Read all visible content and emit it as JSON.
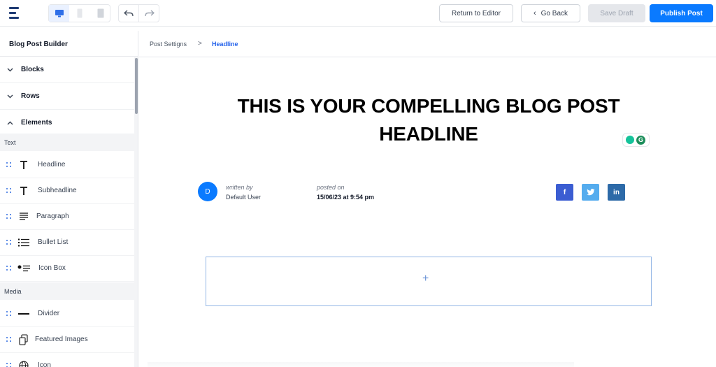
{
  "topbar": {
    "logo_icon": "logo-icon",
    "devices": [
      {
        "name": "desktop-icon",
        "active": true
      },
      {
        "name": "tablet-icon",
        "active": false
      },
      {
        "name": "mobile-icon",
        "active": false
      }
    ],
    "undo_icon": "undo-icon",
    "redo_icon": "redo-icon",
    "return_label": "Return to Editor",
    "back_label": "Go Back",
    "save_draft_label": "Save Draft",
    "publish_label": "Publish Post",
    "accent_color": "#0a7aff"
  },
  "sidebar": {
    "title": "Blog Post Builder",
    "accordions": [
      {
        "label": "Blocks",
        "expanded": false
      },
      {
        "label": "Rows",
        "expanded": false
      },
      {
        "label": "Elements",
        "expanded": true
      }
    ],
    "sections": [
      {
        "heading": "Text",
        "items": [
          {
            "label": "Headline",
            "icon": "text-t-icon"
          },
          {
            "label": "Subheadline",
            "icon": "text-t-icon"
          },
          {
            "label": "Paragraph",
            "icon": "paragraph-icon"
          },
          {
            "label": "Bullet List",
            "icon": "bullet-list-icon"
          },
          {
            "label": "Icon Box",
            "icon": "icon-box-icon"
          }
        ]
      },
      {
        "heading": "Media",
        "items": [
          {
            "label": "Divider",
            "icon": "divider-icon"
          },
          {
            "label": "Featured Images",
            "icon": "featured-images-icon"
          },
          {
            "label": "Icon",
            "icon": "icon-icon"
          }
        ]
      }
    ]
  },
  "breadcrumb": {
    "items": [
      "Post Settigns",
      "Headline"
    ],
    "separator": ">"
  },
  "post": {
    "headline_line1": "THIS IS YOUR COMPELLING BLOG POST",
    "headline_line2": "HEADLINE",
    "author_initial": "D",
    "written_by_label": "written by",
    "author_name": "Default User",
    "posted_on_label": "posted on",
    "posted_date": "15/06/23 at 9:54 pm",
    "social": [
      {
        "name": "facebook-icon",
        "glyph": "f",
        "color": "#3b5dd2"
      },
      {
        "name": "twitter-icon",
        "glyph": "t",
        "color": "#55acee"
      },
      {
        "name": "linkedin-icon",
        "glyph": "in",
        "color": "#2d6aa8"
      }
    ],
    "add_block_glyph": "+"
  }
}
